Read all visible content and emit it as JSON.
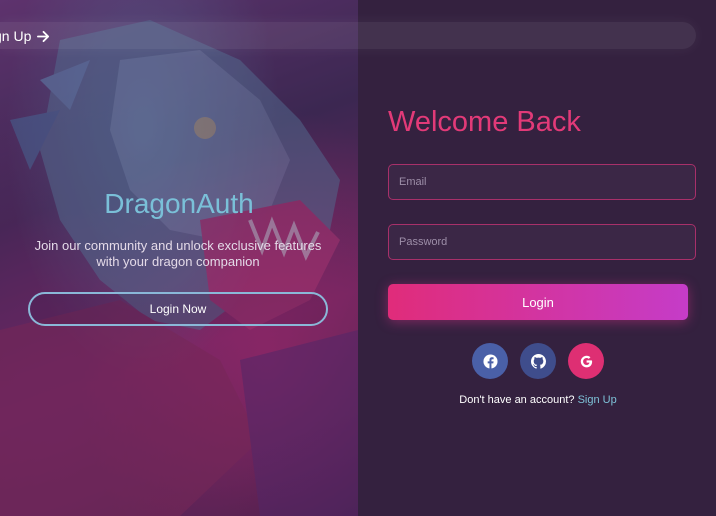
{
  "brand": {
    "name": "DragonAuth",
    "tagline": "Join our community and unlock exclusive features with your dragon companion",
    "login_now_label": "Login Now"
  },
  "top_nav": {
    "signup_label": "gn Up",
    "icon": "arrow-right-icon"
  },
  "login_form": {
    "title": "Welcome Back",
    "email_placeholder": "Email",
    "password_placeholder": "Password",
    "submit_label": "Login"
  },
  "social_login": [
    {
      "name": "facebook",
      "icon": "facebook-icon",
      "color": "#4a60a8"
    },
    {
      "name": "github",
      "icon": "github-icon",
      "color": "#3f4d8c"
    },
    {
      "name": "google",
      "icon": "google-icon",
      "color": "#de2f73"
    }
  ],
  "signup_prompt": {
    "text": "Don't have an account?",
    "link_label": "Sign Up"
  },
  "colors": {
    "accent": "#e23a78",
    "brand_text": "#7ac0d8",
    "panel_bg": "#34213f",
    "link": "#7ec2d8"
  }
}
